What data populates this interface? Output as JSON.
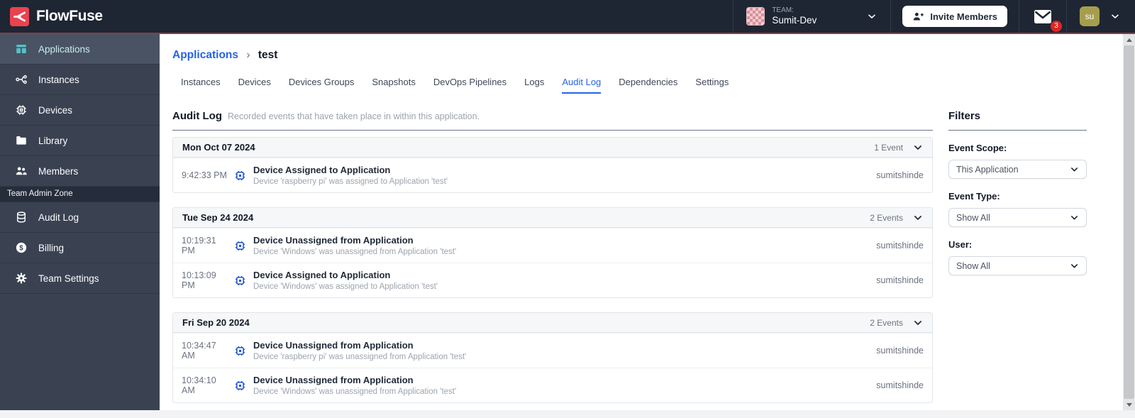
{
  "header": {
    "logo_text": "FlowFuse",
    "team_label": "TEAM:",
    "team_name": "Sumit-Dev",
    "invite_button_label": "Invite Members",
    "notification_badge": "3",
    "user_initials": "su"
  },
  "sidebar": {
    "items": [
      {
        "label": "Applications",
        "icon": "applications-icon",
        "active": true
      },
      {
        "label": "Instances",
        "icon": "instances-icon",
        "active": false
      },
      {
        "label": "Devices",
        "icon": "devices-icon",
        "active": false
      },
      {
        "label": "Library",
        "icon": "library-icon",
        "active": false
      },
      {
        "label": "Members",
        "icon": "members-icon",
        "active": false
      }
    ],
    "admin_zone_label": "Team Admin Zone",
    "admin_items": [
      {
        "label": "Audit Log",
        "icon": "audit-log-icon"
      },
      {
        "label": "Billing",
        "icon": "billing-icon"
      },
      {
        "label": "Team Settings",
        "icon": "gear-icon"
      }
    ]
  },
  "breadcrumb": {
    "parent": "Applications",
    "separator": "›",
    "current": "test"
  },
  "tabs": [
    {
      "label": "Instances",
      "active": false
    },
    {
      "label": "Devices",
      "active": false
    },
    {
      "label": "Devices Groups",
      "active": false
    },
    {
      "label": "Snapshots",
      "active": false
    },
    {
      "label": "DevOps Pipelines",
      "active": false
    },
    {
      "label": "Logs",
      "active": false
    },
    {
      "label": "Audit Log",
      "active": true
    },
    {
      "label": "Dependencies",
      "active": false
    },
    {
      "label": "Settings",
      "active": false
    }
  ],
  "audit_log": {
    "title": "Audit Log",
    "subtitle": "Recorded events that have taken place in within this application.",
    "groups": [
      {
        "date": "Mon Oct 07 2024",
        "count_label": "1 Event",
        "events": [
          {
            "time": "9:42:33 PM",
            "title": "Device Assigned to Application",
            "description": "Device 'raspberry pi' was assigned to Application 'test'",
            "user": "sumitshinde"
          }
        ]
      },
      {
        "date": "Tue Sep 24 2024",
        "count_label": "2 Events",
        "events": [
          {
            "time": "10:19:31 PM",
            "title": "Device Unassigned from Application",
            "description": "Device 'Windows' was unassigned from Application 'test'",
            "user": "sumitshinde"
          },
          {
            "time": "10:13:09 PM",
            "title": "Device Assigned to Application",
            "description": "Device 'Windows' was assigned to Application 'test'",
            "user": "sumitshinde"
          }
        ]
      },
      {
        "date": "Fri Sep 20 2024",
        "count_label": "2 Events",
        "events": [
          {
            "time": "10:34:47 AM",
            "title": "Device Unassigned from Application",
            "description": "Device 'raspberry pi' was unassigned from Application 'test'",
            "user": "sumitshinde"
          },
          {
            "time": "10:34:10 AM",
            "title": "Device Unassigned from Application",
            "description": "Device 'Windows' was unassigned from Application 'test'",
            "user": "sumitshinde"
          }
        ]
      }
    ]
  },
  "filters": {
    "title": "Filters",
    "fields": [
      {
        "label": "Event Scope:",
        "value": "This Application"
      },
      {
        "label": "Event Type:",
        "value": "Show All"
      },
      {
        "label": "User:",
        "value": "Show All"
      }
    ]
  },
  "colors": {
    "accent_blue": "#2563eb",
    "header_bg": "#1e2634",
    "sidebar_bg": "#3a4252",
    "sidebar_active_teal": "#54c3c9",
    "brand_red": "#e9434f",
    "header_red_line": "#8e3a44",
    "badge_red": "#dc2626",
    "event_icon_blue": "#2457cf"
  }
}
